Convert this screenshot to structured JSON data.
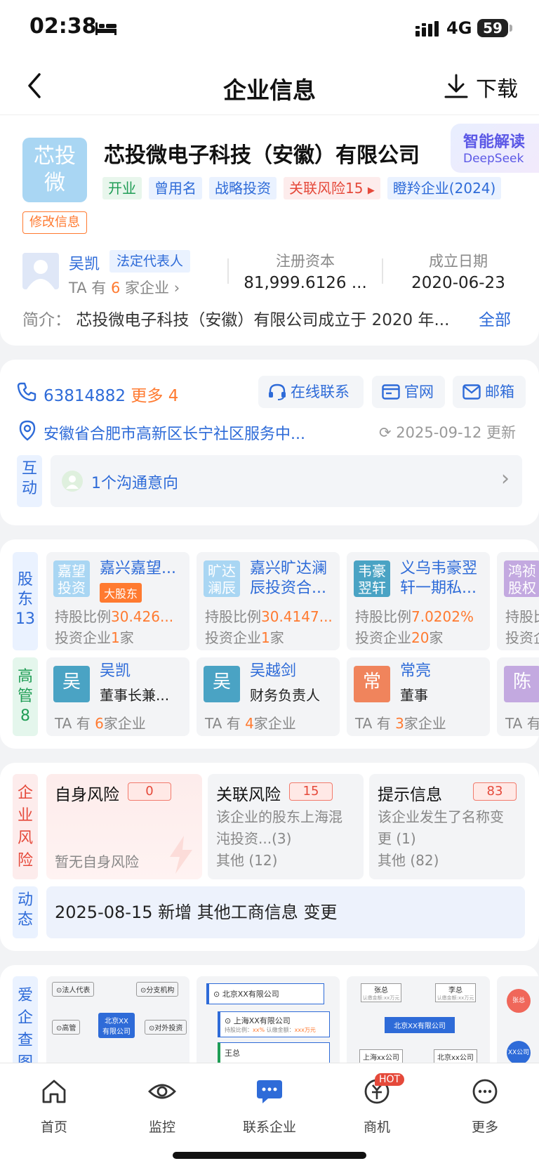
{
  "status": {
    "time": "02:38",
    "network": "4G",
    "battery": "59"
  },
  "nav": {
    "title": "企业信息",
    "download": "下载"
  },
  "company": {
    "logo_text_1": "芯投",
    "logo_text_2": "微",
    "name": "芯投微电子科技（安徽）有限公司",
    "ai_title": "智能解读",
    "ai_sub": "DeepSeek",
    "tags": [
      "开业",
      "曾用名",
      "战略投资",
      "关联风险15",
      "瞪羚企业(2024)"
    ],
    "edit_label": "修改信息",
    "rep_name": "吴凯",
    "rep_badge": "法定代表人",
    "rep_sub_prefix": "TA 有",
    "rep_sub_count": "6",
    "rep_sub_suffix": "家企业",
    "capital_label": "注册资本",
    "capital_value": "81,999.6126 ...",
    "date_label": "成立日期",
    "date_value": "2020-06-23",
    "intro_label": "简介：",
    "intro_text": "芯投微电子科技（安徽）有限公司成立于 2020 年...",
    "intro_more": "全部"
  },
  "contact": {
    "phone": "63814882",
    "phone_more": "更多 4",
    "online": "在线联系",
    "website": "官网",
    "email": "邮箱",
    "address": "安徽省合肥市高新区长宁社区服务中...",
    "updated": "2025-09-12 更新",
    "interact_label": "互动",
    "interact_text": "1个沟通意向"
  },
  "shareholders": {
    "label": "股东13",
    "label_a": "股",
    "label_b": "东",
    "label_c": "13",
    "items": [
      {
        "logo": "嘉望投资",
        "name": "嘉兴嘉望...",
        "badge": "大股东",
        "ratio_label": "持股比例",
        "ratio": "30.426...",
        "inv_label": "投资企业",
        "inv_count": "1",
        "inv_unit": "家"
      },
      {
        "logo": "旷达澜辰",
        "name_1": "嘉兴旷达澜",
        "name_2": "辰投资合...",
        "ratio_label": "持股比例",
        "ratio": "30.4147...",
        "inv_label": "投资企业",
        "inv_count": "1",
        "inv_unit": "家"
      },
      {
        "logo": "韦豪翌轩",
        "name_1": "义乌韦豪翌",
        "name_2": "轩一期私...",
        "ratio_label": "持股比例",
        "ratio": "7.0202%",
        "inv_label": "投资企业",
        "inv_count": "20",
        "inv_unit": "家"
      },
      {
        "logo": "鸿祯股权",
        "ratio_label": "持股比",
        "inv_label": "投资企"
      }
    ]
  },
  "executives": {
    "label_a": "高",
    "label_b": "管",
    "label_c": "8",
    "items": [
      {
        "logo": "吴",
        "name": "吴凯",
        "role": "董事长兼...",
        "pre": "TA 有",
        "count": "6",
        "suf": "家企业"
      },
      {
        "logo": "吴",
        "name": "吴越剑",
        "role": "财务负责人",
        "pre": "TA 有",
        "count": "4",
        "suf": "家企业"
      },
      {
        "logo": "常",
        "name": "常亮",
        "role": "董事",
        "pre": "TA 有",
        "count": "3",
        "suf": "家企业"
      },
      {
        "logo": "陈",
        "pre": "TA 有"
      }
    ]
  },
  "risk": {
    "label": "企业风险",
    "self_title": "自身风险",
    "self_count": "0",
    "self_desc": "暂无自身风险",
    "rel_title": "关联风险",
    "rel_count": "15",
    "rel_desc_1": "该企业的股东上海混",
    "rel_desc_2": "沌投资...(3)",
    "rel_desc_3": "其他 (12)",
    "tip_title": "提示信息",
    "tip_count": "83",
    "tip_desc_1": "该企业发生了名称变",
    "tip_desc_2": "更 (1)",
    "tip_desc_3": "其他 (82)"
  },
  "dynamic": {
    "label_a": "动",
    "label_b": "态",
    "text": "2025-08-15 新增 其他工商信息 变更"
  },
  "graph": {
    "label": "爱企查图",
    "d1": {
      "legal": "法人代表",
      "branch": "分支机构",
      "center_1": "北京XX",
      "center_2": "有限公司",
      "exec": "高管",
      "invest": "对外投资"
    },
    "d2": {
      "c1": "北京XX有限公司",
      "c2": "上海XX有限公司",
      "c2_sub_a": "持股比例：",
      "c2_sub_b": "xx%",
      "c2_sub_c": "认缴金额：",
      "c2_sub_d": "xxx万元",
      "c3": "王总"
    },
    "d3": {
      "p1": "张总",
      "p2": "李总",
      "p_sub": "认缴金额:xx万元",
      "center": "北京XX有限公司",
      "b1": "上海xx公司",
      "b2": "北京xx公司"
    },
    "d4": {
      "a": "张总",
      "b": "XX公司"
    }
  },
  "tabbar": {
    "home": "首页",
    "monitor": "监控",
    "contact": "联系企业",
    "biz": "商机",
    "hot": "HOT",
    "more": "更多"
  },
  "colors": {
    "blue": "#2e6bd8",
    "orange": "#ff7a30",
    "red": "#e5493a",
    "green": "#1f9d55"
  }
}
